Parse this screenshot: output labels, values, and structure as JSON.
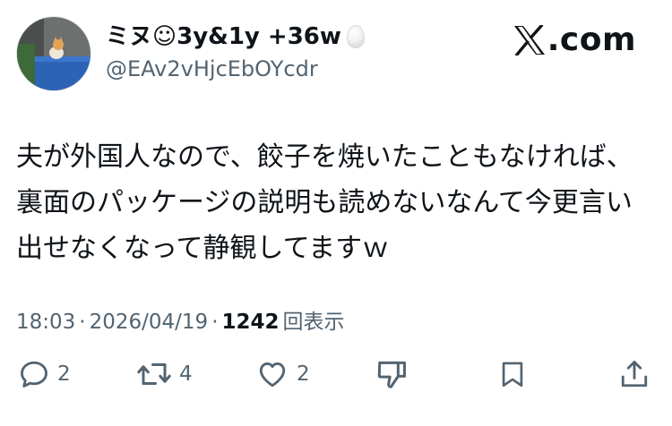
{
  "user": {
    "display_name": "ミヌ☺3y&1y +36w",
    "handle": "@EAv2vHjcEbOYcdr"
  },
  "brand": {
    "logo_icon": "x-logo-icon",
    "text": ".com"
  },
  "tweet": {
    "lines": [
      "夫が外国人なので、餃子を焼いたこともなければ、",
      "裏面のパッケージの説明も読めないなんて今更言い",
      "出せなくなって静観してますｗ"
    ]
  },
  "meta": {
    "time": "18:03",
    "separator": "·",
    "date": "2026/04/19",
    "views": "1242",
    "views_label": "回表示"
  },
  "actions": {
    "reply_count": "2",
    "retweet_count": "4",
    "like_count": "2"
  },
  "colors": {
    "text": "#0f1419",
    "secondary": "#536471"
  }
}
